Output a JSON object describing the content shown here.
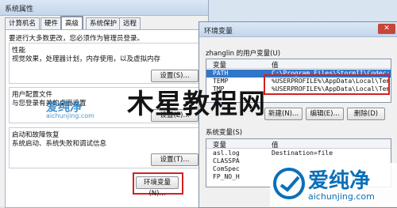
{
  "system_properties": {
    "title": "系统属性",
    "tabs": [
      "计算机名",
      "硬件",
      "高级",
      "系统保护",
      "远程"
    ],
    "admin_note": "要进行大多数更改，您必须作为管理员登录。",
    "performance": {
      "title": "性能",
      "description": "视觉效果，处理器计划，内存使用，以及虚拟内存",
      "button": "设置(S)..."
    },
    "user_profiles": {
      "title": "用户配置文件",
      "description": "与您登录有关的桌面设置",
      "button": "设置(E)..."
    },
    "startup_recovery": {
      "title": "启动和故障恢复",
      "description": "系统启动、系统失败和调试信息",
      "button": "设置(T)..."
    },
    "env_button": "环境变量(N)..."
  },
  "env_window": {
    "title": "环境变量",
    "user_vars_label": "zhanglin 的用户变量(U)",
    "columns": [
      "变量",
      "值"
    ],
    "user_vars": [
      {
        "name": "PATH",
        "value": "C:\\Program Files\\StormII\\Codec;"
      },
      {
        "name": "TEMP",
        "value": "%USERPROFILE%\\AppData\\Local\\Temp"
      },
      {
        "name": "TMP",
        "value": "%USERPROFILE%\\AppData\\Local\\Temp"
      }
    ],
    "user_buttons": [
      "新建(N)...",
      "编辑(E)...",
      "删除(D)"
    ],
    "sys_vars_label": "系统变量(S)",
    "sys_vars": [
      {
        "name": "asl.log",
        "value": "Destination=file"
      },
      {
        "name": "CLASSPA",
        "value": ""
      },
      {
        "name": "ComSpec",
        "value": ""
      },
      {
        "name": "FP_NO_H",
        "value": ""
      }
    ],
    "close_glyph": "✕"
  },
  "watermarks": {
    "center_text": "木星教程网",
    "small_brand": "爱纯净",
    "small_url": "aichunjing.com",
    "corner_brand": "爱纯净",
    "corner_url": "aichunjing.com"
  },
  "colors": {
    "highlight_red": "#d42020",
    "selection_blue": "#3176c9",
    "watermark_blue": "#0b6fb8"
  }
}
